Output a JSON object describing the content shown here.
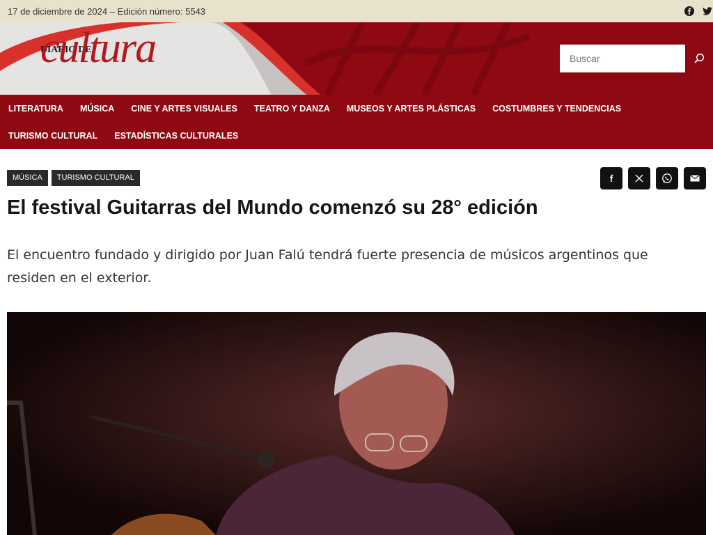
{
  "topbar": {
    "date_edition": "17 de diciembre de 2024 – Edición número: 5543",
    "social": [
      "facebook-icon",
      "twitter-icon"
    ]
  },
  "header": {
    "logo_small": "DIARIO DE",
    "logo_big": "cultura",
    "search_placeholder": "Buscar",
    "colors": {
      "brand": "#8e0911",
      "logo_red": "#b01a1f"
    }
  },
  "nav": {
    "items": [
      {
        "label": "LITERATURA"
      },
      {
        "label": "MÚSICA"
      },
      {
        "label": "CINE Y ARTES VISUALES"
      },
      {
        "label": "TEATRO Y DANZA"
      },
      {
        "label": "MUSEOS Y ARTES PLÁSTICAS"
      },
      {
        "label": "COSTUMBRES Y TENDENCIAS"
      },
      {
        "label": "TURISMO CULTURAL"
      },
      {
        "label": "ESTADÍSTICAS CULTURALES"
      }
    ]
  },
  "article": {
    "tags": [
      "MÚSICA",
      "TURISMO CULTURAL"
    ],
    "title": "El festival Guitarras del Mundo comenzó su 28° edición",
    "lead": "El encuentro fundado y dirigido por Juan Falú tendrá fuerte presencia de músicos argentinos que residen en el exterior.",
    "share": [
      "facebook-icon",
      "x-icon",
      "whatsapp-icon",
      "email-icon"
    ]
  }
}
